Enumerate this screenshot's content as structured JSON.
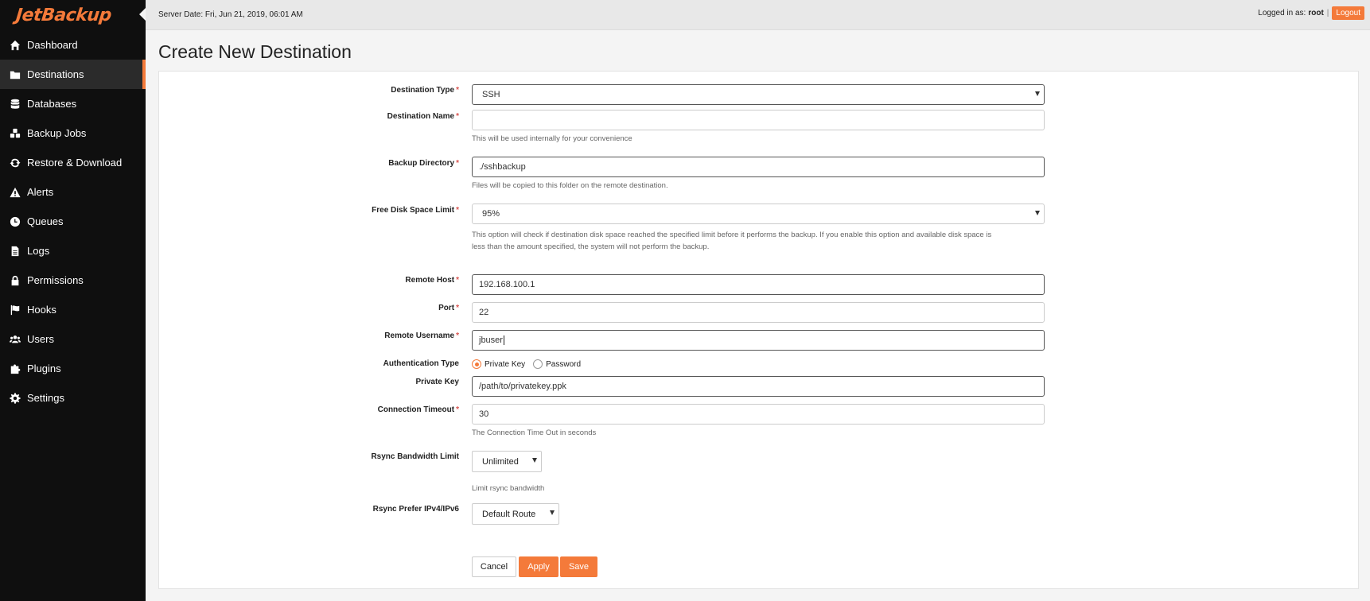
{
  "brand": {
    "logo_text": "JetBackup",
    "accent_color": "#f47a3a"
  },
  "topbar": {
    "server_date": "Server Date: Fri, Jun 21, 2019, 06:01 AM",
    "logged_in_label": "Logged in as:",
    "username": "root",
    "separator": "|",
    "logout_label": "Logout"
  },
  "sidebar": {
    "items": [
      {
        "label": "Dashboard",
        "icon": "home-icon"
      },
      {
        "label": "Destinations",
        "icon": "folder-icon",
        "active": true
      },
      {
        "label": "Databases",
        "icon": "database-icon"
      },
      {
        "label": "Backup Jobs",
        "icon": "cubes-icon"
      },
      {
        "label": "Restore & Download",
        "icon": "refresh-icon"
      },
      {
        "label": "Alerts",
        "icon": "warning-icon"
      },
      {
        "label": "Queues",
        "icon": "clock-icon"
      },
      {
        "label": "Logs",
        "icon": "file-icon"
      },
      {
        "label": "Permissions",
        "icon": "lock-icon"
      },
      {
        "label": "Hooks",
        "icon": "flag-icon"
      },
      {
        "label": "Users",
        "icon": "users-icon"
      },
      {
        "label": "Plugins",
        "icon": "puzzle-icon"
      },
      {
        "label": "Settings",
        "icon": "gear-icon"
      }
    ]
  },
  "page": {
    "title": "Create New Destination"
  },
  "form": {
    "destination_type": {
      "label": "Destination Type",
      "value": "SSH"
    },
    "destination_name": {
      "label": "Destination Name",
      "value": "",
      "help": "This will be used internally for your convenience"
    },
    "backup_directory": {
      "label": "Backup Directory",
      "value": "./sshbackup",
      "help": "Files will be copied to this folder on the remote destination."
    },
    "free_disk_space": {
      "label": "Free Disk Space Limit",
      "value": "95%",
      "help_line1": "This option will check if destination disk space reached the specified limit before it performs the backup. If you enable this option and available disk space is",
      "help_line2": "less than the amount specified, the system will not perform the backup."
    },
    "remote_host": {
      "label": "Remote Host",
      "value": "192.168.100.1"
    },
    "port": {
      "label": "Port",
      "value": "22"
    },
    "remote_username": {
      "label": "Remote Username",
      "value": "jbuser"
    },
    "auth_type": {
      "label": "Authentication Type",
      "option_private_key": "Private Key",
      "option_password": "Password",
      "selected": "Private Key"
    },
    "private_key": {
      "label": "Private Key",
      "value": "/path/to/privatekey.ppk"
    },
    "connection_timeout": {
      "label": "Connection Timeout",
      "value": "30",
      "help": "The Connection Time Out in seconds"
    },
    "rsync_bandwidth": {
      "label": "Rsync Bandwidth Limit",
      "value": "Unlimited",
      "help": "Limit rsync bandwidth"
    },
    "rsync_prefer": {
      "label": "Rsync Prefer IPv4/IPv6",
      "value": "Default Route"
    },
    "required_marker": "*"
  },
  "actions": {
    "cancel": "Cancel",
    "apply": "Apply",
    "save": "Save"
  }
}
